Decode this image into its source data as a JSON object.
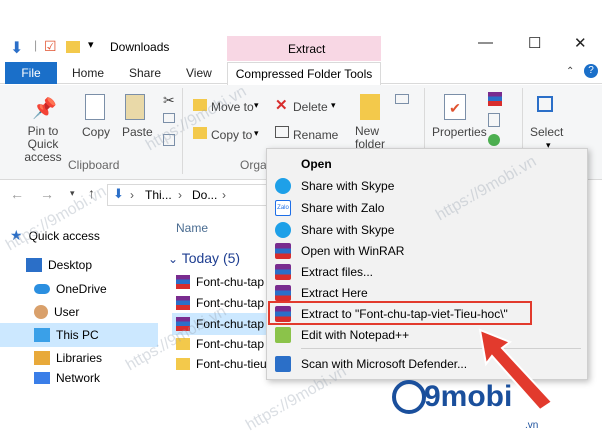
{
  "window": {
    "title": "Downloads",
    "contextual_group": "Extract",
    "controls": {
      "minimize": "—",
      "maximize": "☐",
      "close": "✕"
    }
  },
  "tabs": [
    "File",
    "Home",
    "Share",
    "View",
    "Compressed Folder Tools"
  ],
  "ribbon": {
    "pin": "Pin to Quick access",
    "copy": "Copy",
    "paste": "Paste",
    "move_to": "Move to",
    "copy_to": "Copy to",
    "delete": "Delete",
    "rename": "Rename",
    "new_folder": "New folder",
    "properties": "Properties",
    "select": "Select",
    "group_clipboard": "Clipboard",
    "group_organize": "Orga"
  },
  "address": {
    "crumb1": "Thi...",
    "crumb2": "Do..."
  },
  "nav": {
    "quick_access": "Quick access",
    "desktop": "Desktop",
    "onedrive": "OneDrive",
    "user": "User",
    "this_pc": "This PC",
    "libraries": "Libraries",
    "network": "Network"
  },
  "content": {
    "col_name": "Name",
    "group": "Today (5)",
    "files": [
      "Font-chu-tap",
      "Font-chu-tap",
      "Font-chu-tap",
      "Font-chu-tap",
      "Font-chu-tieu"
    ]
  },
  "menu": {
    "items": [
      "Open",
      "Share with Skype",
      "Share with Zalo",
      "Share with Skype",
      "Open with WinRAR",
      "Extract files...",
      "Extract Here",
      "Extract to \"Font-chu-tap-viet-Tieu-hoc\\\"",
      "Edit with Notepad++",
      "Scan with Microsoft Defender..."
    ]
  },
  "watermark": {
    "text": "https://9mobi.vn",
    "logo": "9mobi",
    "logo_sub": ".vn"
  },
  "colors": {
    "accent": "#1a6fc9",
    "highlight": "#e23a2d",
    "extract_tab": "#f8d7e4"
  }
}
